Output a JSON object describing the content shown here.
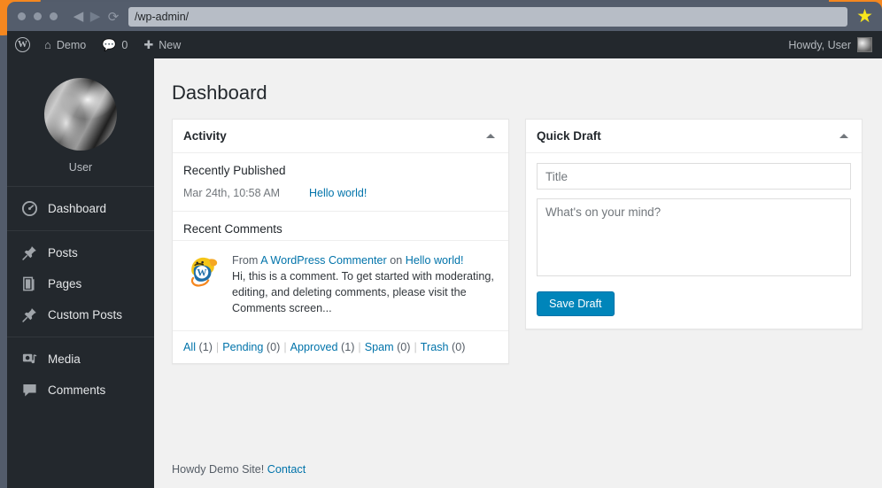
{
  "browser": {
    "url": "/wp-admin/",
    "back_icon": "back-arrow-icon",
    "forward_icon": "forward-arrow-icon",
    "reload_icon": "reload-icon",
    "bookmark_icon": "star-icon"
  },
  "adminbar": {
    "logo": "wordpress-logo-icon",
    "site_name": "Demo",
    "comments_count": "0",
    "new_label": "New",
    "greeting": "Howdy, User"
  },
  "sidebar": {
    "profile_name": "User",
    "groups": [
      {
        "items": [
          {
            "label": "Dashboard",
            "icon": "dashboard-gauge-icon"
          }
        ]
      },
      {
        "items": [
          {
            "label": "Posts",
            "icon": "pushpin-icon"
          },
          {
            "label": "Pages",
            "icon": "pages-icon"
          },
          {
            "label": "Custom Posts",
            "icon": "pushpin-icon"
          }
        ]
      },
      {
        "items": [
          {
            "label": "Media",
            "icon": "media-icon"
          },
          {
            "label": "Comments",
            "icon": "comment-bubble-icon"
          }
        ]
      }
    ]
  },
  "main": {
    "page_title": "Dashboard",
    "activity": {
      "title": "Activity",
      "recently_published_title": "Recently Published",
      "published": [
        {
          "date": "Mar 24th, 10:58 AM",
          "title": "Hello world!"
        }
      ],
      "recent_comments_title": "Recent Comments",
      "comment": {
        "avatar": "wapuu-mascot-avatar",
        "from_label": "From",
        "author": "A WordPress Commenter",
        "on_label": "on",
        "post": "Hello world!",
        "excerpt": "Hi, this is a comment. To get started with moderating, editing, and deleting comments, please visit the Comments screen..."
      },
      "filters": [
        {
          "label": "All",
          "count": "(1)"
        },
        {
          "label": "Pending",
          "count": "(0)"
        },
        {
          "label": "Approved",
          "count": "(1)"
        },
        {
          "label": "Spam",
          "count": "(0)"
        },
        {
          "label": "Trash",
          "count": "(0)"
        }
      ]
    },
    "quick_draft": {
      "title": "Quick Draft",
      "title_placeholder": "Title",
      "title_value": "",
      "content_placeholder": "What's on your mind?",
      "content_value": "",
      "save_label": "Save Draft"
    }
  },
  "footer": {
    "text": "Howdy Demo Site!",
    "link": "Contact"
  },
  "colors": {
    "accent": "#0073aa",
    "button": "#0085ba",
    "admin_dark": "#23282d",
    "page_bg": "#f1f1f1",
    "star": "#f8e71c"
  }
}
